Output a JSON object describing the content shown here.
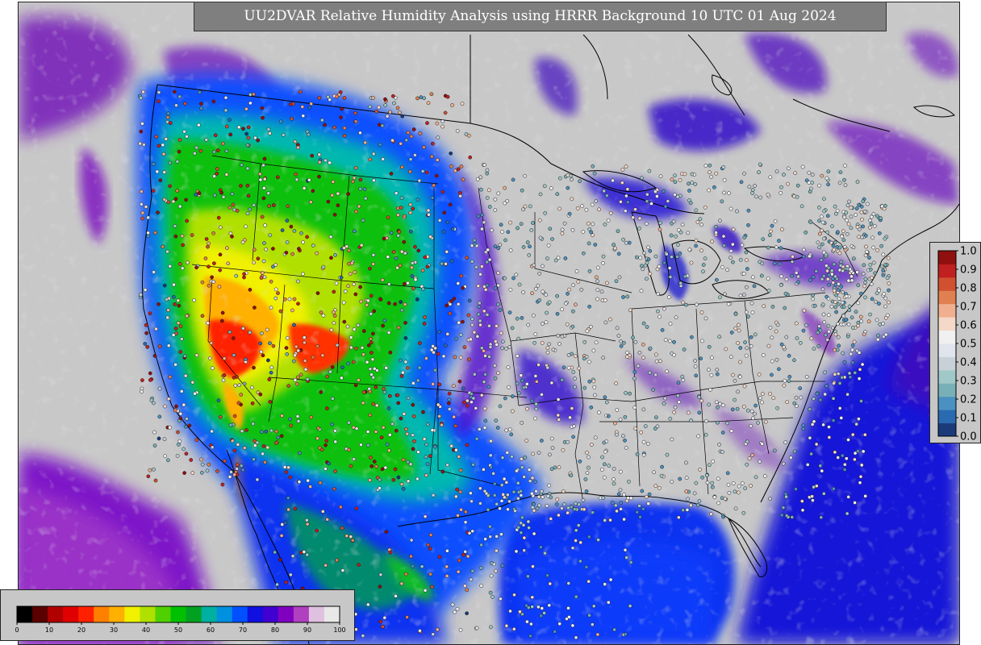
{
  "title": "UU2DVAR Relative Humidity Analysis using HRRR Background 10 UTC 01 Aug 2024",
  "colors": {
    "background_land": "#c8c8c8",
    "humidity_ramp": [
      "#000000",
      "#5a0000",
      "#b00000",
      "#e00000",
      "#ff2000",
      "#ff8000",
      "#ffb000",
      "#f0f000",
      "#b0e000",
      "#50d000",
      "#00c000",
      "#00a020",
      "#00b0a0",
      "#0090e0",
      "#0050ff",
      "#1010e0",
      "#4000d0",
      "#8000c0",
      "#b040c0",
      "#e0c0e0",
      "#e8e8e8"
    ],
    "observation_ramp": [
      "#1a3a7a",
      "#2a6ab0",
      "#4a90c0",
      "#78b0b8",
      "#a0c8c8",
      "#c8d0d8",
      "#e0e4ec",
      "#f0f0f0",
      "#f4d8c8",
      "#f0b090",
      "#e08050",
      "#d05030",
      "#c02020",
      "#901010"
    ]
  },
  "humidity_legend": {
    "tick_labels": [
      "0",
      "10",
      "20",
      "30",
      "40",
      "50",
      "60",
      "70",
      "80",
      "90",
      "100"
    ]
  },
  "observation_legend": {
    "tick_labels": [
      "0.0",
      "0.1",
      "0.2",
      "0.3",
      "0.4",
      "0.5",
      "0.6",
      "0.7",
      "0.8",
      "0.9",
      "1.0"
    ]
  }
}
